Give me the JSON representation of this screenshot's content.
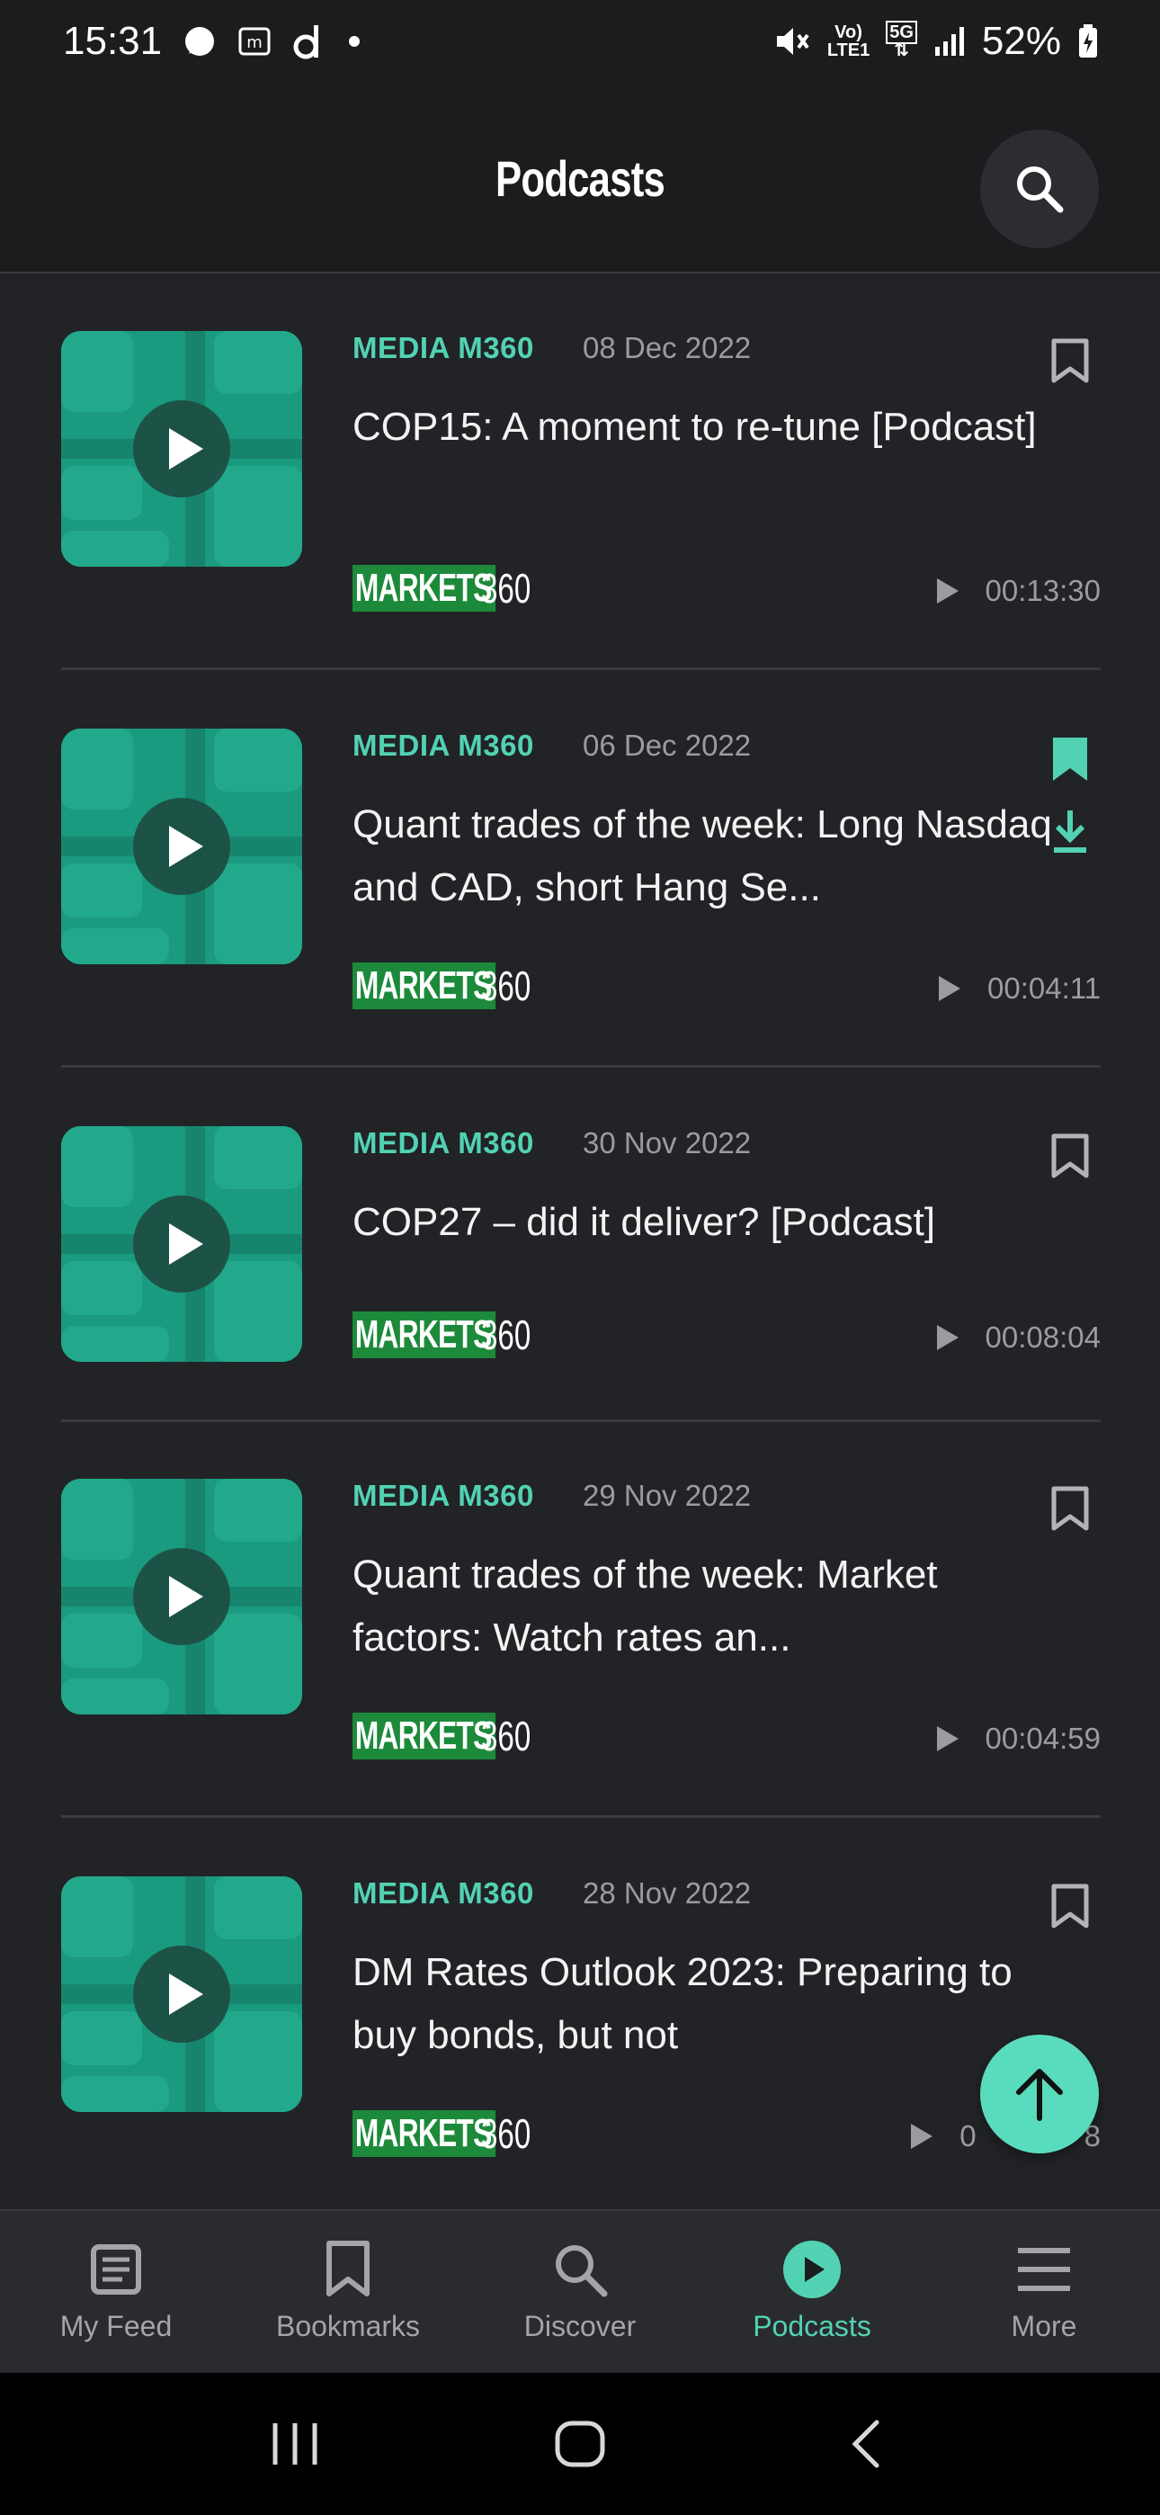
{
  "status_bar": {
    "time": "15:31",
    "battery": "52%",
    "volte": "Vo)",
    "lte": "LTE1",
    "network": "5G",
    "icons": [
      "signal-messenger-icon",
      "m-app-icon",
      "d-app-icon",
      "dot-icon",
      "mute-icon",
      "volte-icon",
      "5g-icon",
      "signal-bars-icon",
      "battery-charging-icon"
    ]
  },
  "header": {
    "title": "Podcasts",
    "search_icon": "search-icon"
  },
  "colors": {
    "accent": "#52d2b3",
    "fab": "#59dcbd",
    "background": "#222326",
    "header_bg": "#1b1c1e",
    "brand_green": "#1c8a3a",
    "thumb_green": "#1a9a7f"
  },
  "podcasts": [
    {
      "source": "MEDIA M360",
      "date": "08 Dec 2022",
      "title": "COP15: A moment to re-tune [Podcast]",
      "brand_markets": "MARKETS",
      "brand_360": "360",
      "duration": "00:13:30",
      "bookmarked": false,
      "downloaded": false
    },
    {
      "source": "MEDIA M360",
      "date": "06 Dec 2022",
      "title": "Quant trades of the week: Long Nasdaq and CAD, short Hang Se...",
      "brand_markets": "MARKETS",
      "brand_360": "360",
      "duration": "00:04:11",
      "bookmarked": true,
      "downloaded": true
    },
    {
      "source": "MEDIA M360",
      "date": "30 Nov 2022",
      "title": "COP27 – did it deliver? [Podcast]",
      "brand_markets": "MARKETS",
      "brand_360": "360",
      "duration": "00:08:04",
      "bookmarked": false,
      "downloaded": false
    },
    {
      "source": "MEDIA M360",
      "date": "29 Nov 2022",
      "title": "Quant trades of the week: Market factors: Watch rates an...",
      "brand_markets": "MARKETS",
      "brand_360": "360",
      "duration": "00:04:59",
      "bookmarked": false,
      "downloaded": false
    },
    {
      "source": "MEDIA M360",
      "date": "28 Nov 2022",
      "title": "DM Rates Outlook 2023: Preparing to buy bonds, but not",
      "brand_markets": "MARKETS",
      "brand_360": "360",
      "duration": "0",
      "duration_tail": "8",
      "bookmarked": false,
      "downloaded": false
    }
  ],
  "fab": {
    "icon": "arrow-up-icon"
  },
  "bottom_nav": {
    "active": "Podcasts",
    "items": [
      {
        "label": "My Feed",
        "icon": "feed-icon"
      },
      {
        "label": "Bookmarks",
        "icon": "bookmark-icon"
      },
      {
        "label": "Discover",
        "icon": "search-icon"
      },
      {
        "label": "Podcasts",
        "icon": "play-circle-icon"
      },
      {
        "label": "More",
        "icon": "menu-icon"
      }
    ]
  },
  "system_nav": {
    "icons": [
      "recent-apps-icon",
      "home-icon",
      "back-icon"
    ]
  }
}
